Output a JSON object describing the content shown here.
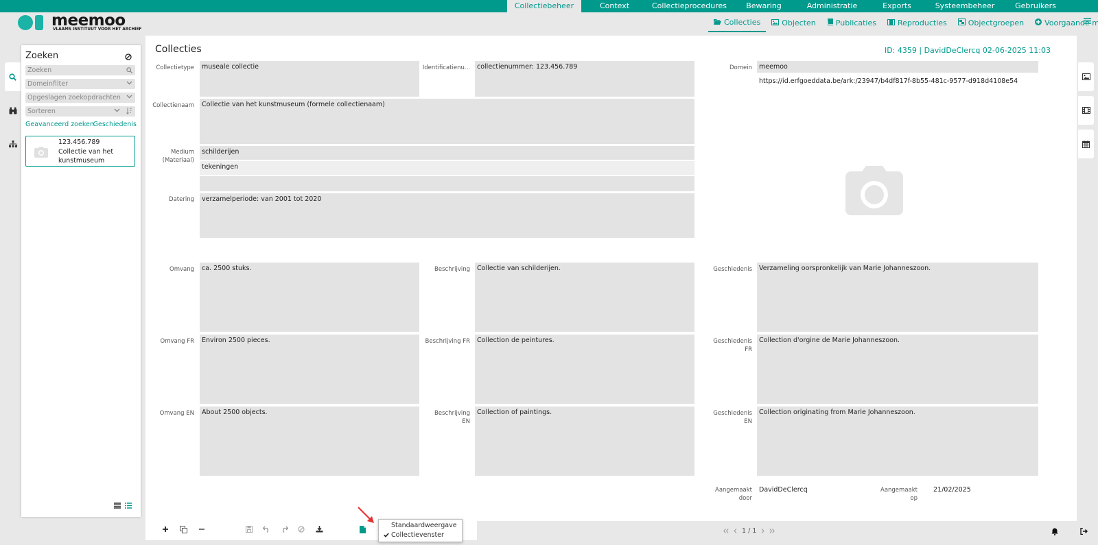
{
  "topnav": {
    "items": [
      {
        "label": "Collectiebeheer",
        "active": true
      },
      {
        "label": "Context"
      },
      {
        "label": "Collectieprocedures"
      },
      {
        "label": "Bewaring"
      },
      {
        "label": "Administratie"
      },
      {
        "label": "Exports"
      },
      {
        "label": "Systeembeheer"
      },
      {
        "label": "Gebruikers"
      }
    ]
  },
  "logo": {
    "word": "meemoo",
    "subtitle": "VLAAMS INSTITUUT VOOR HET ARCHIEF"
  },
  "subnav": {
    "items": [
      {
        "label": "Collecties",
        "icon": "folder-open-icon",
        "active": true
      },
      {
        "label": "Objecten",
        "icon": "image-icon"
      },
      {
        "label": "Publicaties",
        "icon": "book-icon"
      },
      {
        "label": "Reproducties",
        "icon": "film-icon"
      },
      {
        "label": "Objectgroepen",
        "icon": "object-group-icon"
      },
      {
        "label": "Voorgaande module",
        "icon": "arrow-circle-left-icon"
      }
    ]
  },
  "search": {
    "title": "Zoeken",
    "placeholder": "Zoeken",
    "domain_filter": "Domeinfilter",
    "saved_queries": "Opgeslagen zoekopdrachten",
    "sort": "Sorteren",
    "advanced_link": "Geavanceerd zoeken",
    "history_link": "Geschiedenis",
    "result": {
      "number": "123.456.789",
      "name": "Collectie van het kunstmuseum"
    }
  },
  "main": {
    "title": "Collecties",
    "id_info": "ID: 4359 | DavidDeClercq 02-06-2025 11:03",
    "fields": {
      "collectietype": {
        "label": "Collectietype",
        "value": "museale collectie"
      },
      "identificatie": {
        "label": "Identificatienu...",
        "value": "collectienummer: 123.456.789"
      },
      "domein": {
        "label": "Domein",
        "value": "meemoo",
        "uri": "https://id.erfgoeddata.be/ark:/23947/b4df817f-8b55-481c-9577-d918d4108e54"
      },
      "collectienaam": {
        "label": "Collectienaam",
        "value": "Collectie van het kunstmuseum (formele collectienaam)"
      },
      "medium": {
        "label_1": "Medium",
        "label_2": "(Materiaal)",
        "values": [
          "schilderijen",
          "tekeningen"
        ]
      },
      "datering": {
        "label": "Datering",
        "value": "verzamelperiode: van 2001 tot 2020"
      },
      "omvang": {
        "label": "Omvang",
        "value": "ca. 2500 stuks."
      },
      "beschrijving": {
        "label": "Beschrijving",
        "value": "Collectie van schilderijen."
      },
      "geschiedenis": {
        "label": "Geschiedenis",
        "value": "Verzameling oorspronkelijk van Marie Johanneszoon."
      },
      "omvang_fr": {
        "label": "Omvang FR",
        "value": "Environ 2500 pieces."
      },
      "beschrijving_fr": {
        "label": "Beschrijving FR",
        "value": "Collection de peintures."
      },
      "geschiedenis_fr": {
        "label_1": "Geschiedenis",
        "label_2": "FR",
        "value": "Collection d'orgine de Marie Johanneszoon."
      },
      "omvang_en": {
        "label": "Omvang EN",
        "value": "About 2500 objects."
      },
      "beschrijving_en": {
        "label_1": "Beschrijving",
        "label_2": "EN",
        "value": "Collection of paintings."
      },
      "geschiedenis_en": {
        "label_1": "Geschiedenis",
        "label_2": "EN",
        "value": "Collection originating from Marie Johanneszoon."
      },
      "aangemaakt_door": {
        "label_1": "Aangemaakt",
        "label_2": "door",
        "value": "DavidDeClercq"
      },
      "aangemaakt_op": {
        "label_1": "Aangemaakt",
        "label_2": "op",
        "value": "21/02/2025"
      }
    }
  },
  "popup": {
    "items": [
      "Standaardweergave",
      "Collectievenster"
    ],
    "checked": "Collectievenster"
  },
  "pager": {
    "text": "1 / 1"
  },
  "colors": {
    "accent": "#009a8d",
    "field_bg": "#e3e3e3",
    "background": "#e8e8e8"
  }
}
